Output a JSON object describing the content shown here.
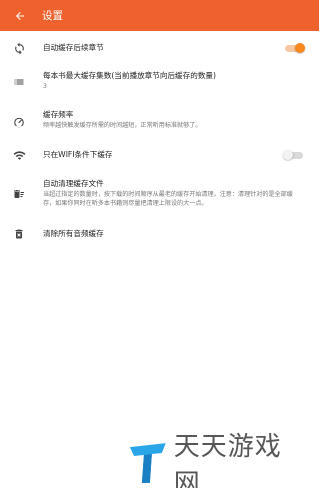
{
  "header": {
    "title": "设置",
    "back_icon": "arrow-left-icon",
    "background_color": "#f0622d"
  },
  "settings": [
    {
      "icon": "sync-icon",
      "title": "自动缓存后续章节",
      "switch": true
    },
    {
      "icon": "list-icon",
      "title": "每本书最大缓存集数(当前播放章节向后缓存的数量)",
      "value": "3"
    },
    {
      "icon": "speedometer-icon",
      "title": "缓存频率",
      "subtitle": "频率越快触发缓存所需的时间越短，正常听用标准就够了。"
    },
    {
      "icon": "wifi-icon",
      "title": "只在WIFI条件下缓存",
      "switch": false
    },
    {
      "icon": "auto-delete-icon",
      "title": "自动清理缓存文件",
      "subtitle": "当超过指定的数量时，按下载的时间顺序从最老的缓存开始清理。注意：清理针对的是全部缓存，如果你同时在听多本书籍则尽量把清理上限设的大一点。"
    },
    {
      "icon": "trash-icon",
      "title": "清除所有音频缓存"
    }
  ],
  "accent_color": "#f7891f",
  "watermark": {
    "logo": "tiantian-logo-icon",
    "text": "天天游戏网"
  }
}
